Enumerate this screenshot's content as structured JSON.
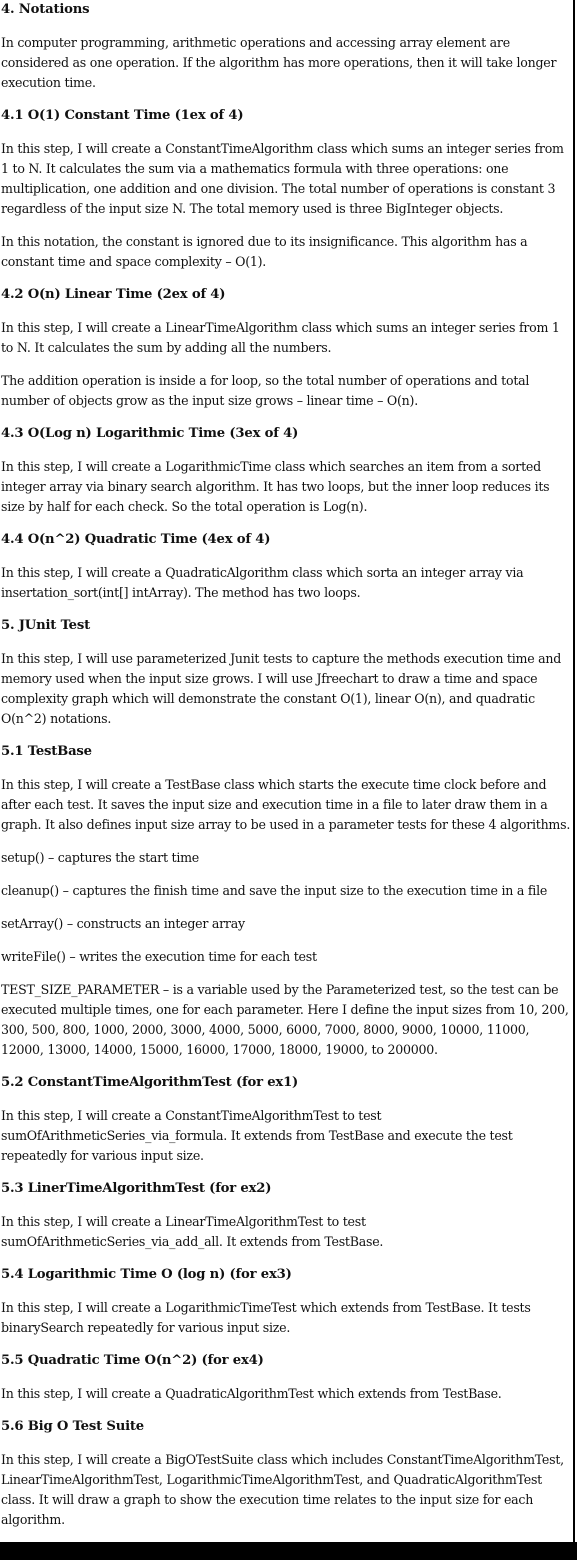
{
  "sections": [
    {
      "type": "heading",
      "text": "4. Notations"
    },
    {
      "type": "para",
      "text": "In computer programming, arithmetic operations and accessing array element are considered as one operation. If the algorithm has more operations, then it will take longer execution time."
    },
    {
      "type": "heading",
      "text": "4.1 O(1) Constant Time (1ex of 4)"
    },
    {
      "type": "para",
      "text": "In this step, I will create a ConstantTimeAlgorithm class which sums an integer series from 1 to N. It calculates the sum via a mathematics formula with three operations: one multiplication, one addition and one division. The total number of operations is constant 3 regardless of the input size N. The total memory used is three BigInteger objects."
    },
    {
      "type": "para",
      "text": "In this notation, the constant is ignored due to its insignificance. This algorithm has a constant time and space complexity – O(1)."
    },
    {
      "type": "heading",
      "text": "4.2 O(n) Linear Time (2ex of 4)"
    },
    {
      "type": "para",
      "text": "In this step, I will create a LinearTimeAlgorithm class which sums an integer series from 1 to N. It calculates the sum by adding all the numbers."
    },
    {
      "type": "para",
      "text": "The addition operation is inside a for loop, so the total number of operations and total number of objects grow as the input size grows – linear time – O(n)."
    },
    {
      "type": "heading",
      "text": "4.3 O(Log n) Logarithmic Time (3ex of 4)"
    },
    {
      "type": "para",
      "text": "In this step, I will create a LogarithmicTime class which searches an item from a sorted integer array via binary search algorithm. It has two loops, but the inner loop reduces its size by half for each check. So the total operation is Log(n)."
    },
    {
      "type": "heading",
      "text": "4.4 O(n^2) Quadratic Time (4ex of 4)"
    },
    {
      "type": "para",
      "text": "In this step, I will create a QuadraticAlgorithm class which sorta an integer array via insertation_sort(int[] intArray). The method has two loops."
    },
    {
      "type": "heading",
      "text": "5. JUnit Test"
    },
    {
      "type": "para",
      "text": "In this step, I will use parameterized Junit tests to capture the methods execution time and memory used when the input size grows. I will use Jfreechart to draw a time and space complexity graph which will demonstrate the constant O(1), linear O(n), and quadratic O(n^2) notations."
    },
    {
      "type": "heading",
      "text": "5.1 TestBase"
    },
    {
      "type": "para",
      "text": "In this step, I will create a TestBase class which starts the execute time clock before and after each test. It saves the input size and execution time in a file to later draw them in a graph. It also defines input size array to be used in a parameter tests for these 4 algorithms."
    },
    {
      "type": "para",
      "text": "setup() – captures the start time"
    },
    {
      "type": "para",
      "text": "cleanup() – captures the finish time and save the input size to the execution time in a file"
    },
    {
      "type": "para",
      "text": "setArray() – constructs an integer array"
    },
    {
      "type": "para",
      "text": "writeFile() – writes the execution time for each test"
    },
    {
      "type": "para",
      "text": "TEST_SIZE_PARAMETER – is a variable used by the Parameterized test, so the test can be executed multiple times, one for each parameter. Here I define the input sizes from 10, 200, 300, 500, 800, 1000, 2000, 3000, 4000, 5000, 6000, 7000, 8000, 9000, 10000, 11000, 12000, 13000, 14000, 15000, 16000, 17000, 18000, 19000, to 200000."
    },
    {
      "type": "heading",
      "text": "5.2 ConstantTimeAlgorithmTest (for ex1)"
    },
    {
      "type": "para",
      "text": "In this step, I will create a ConstantTimeAlgorithmTest to test sumOfArithmeticSeries_via_formula. It extends from TestBase and execute the test repeatedly for various input size."
    },
    {
      "type": "heading",
      "text": "5.3 LinerTimeAlgorithmTest (for ex2)"
    },
    {
      "type": "para",
      "text": "In this step, I will create a LinearTimeAlgorithmTest to test sumOfArithmeticSeries_via_add_all. It extends from TestBase."
    },
    {
      "type": "heading",
      "text": "5.4 Logarithmic Time O (log n) (for ex3)"
    },
    {
      "type": "para",
      "text": "In this step, I will create a LogarithmicTimeTest which extends from TestBase. It tests binarySearch repeatedly for various input size."
    },
    {
      "type": "heading",
      "text": "5.5 Quadratic Time O(n^2) (for ex4)"
    },
    {
      "type": "para",
      "text": "In this step, I will create a QuadraticAlgorithmTest which extends from TestBase."
    },
    {
      "type": "heading",
      "text": "5.6 Big O Test Suite"
    },
    {
      "type": "para",
      "text": "In this step, I will create a BigOTestSuite class which includes ConstantTimeAlgorithmTest, LinearTimeAlgorithmTest, LogarithmicTimeAlgorithmTest, and QuadraticAlgorithmTest class. It will draw a graph to show the execution time relates to the input size for each algorithm."
    }
  ]
}
